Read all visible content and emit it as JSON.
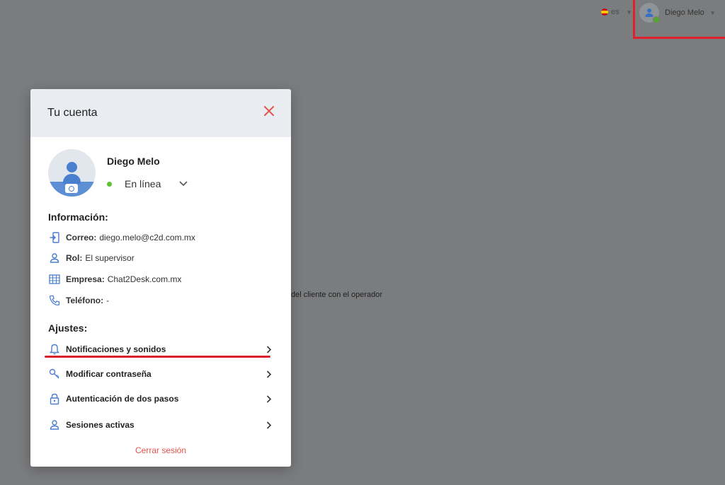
{
  "topbar": {
    "language": "es",
    "user_name": "Diego Melo"
  },
  "background": {
    "text": "del cliente con el operador"
  },
  "modal": {
    "title": "Tu cuenta",
    "profile": {
      "name": "Diego Melo",
      "status": "En línea",
      "status_color": "#5fbf35"
    },
    "info": {
      "title": "Información:",
      "email_label": "Correo:",
      "email_value": "diego.melo@c2d.com.mx",
      "role_label": "Rol:",
      "role_value": "El supervisor",
      "company_label": "Empresa:",
      "company_value": "Chat2Desk.com.mx",
      "phone_label": "Teléfono:",
      "phone_value": "-"
    },
    "settings": {
      "title": "Ajustes:",
      "items": [
        {
          "label": "Notificaciones y sonidos",
          "icon": "bell-icon"
        },
        {
          "label": "Modificar contraseña",
          "icon": "key-icon"
        },
        {
          "label": "Autenticación de dos pasos",
          "icon": "lock-icon"
        },
        {
          "label": "Sesiones activas",
          "icon": "user-icon"
        }
      ]
    },
    "logout_label": "Cerrar sesión"
  },
  "colors": {
    "accent_blue": "#4a7fd0",
    "danger_red": "#e5534b",
    "highlight_red": "#e0212c"
  }
}
